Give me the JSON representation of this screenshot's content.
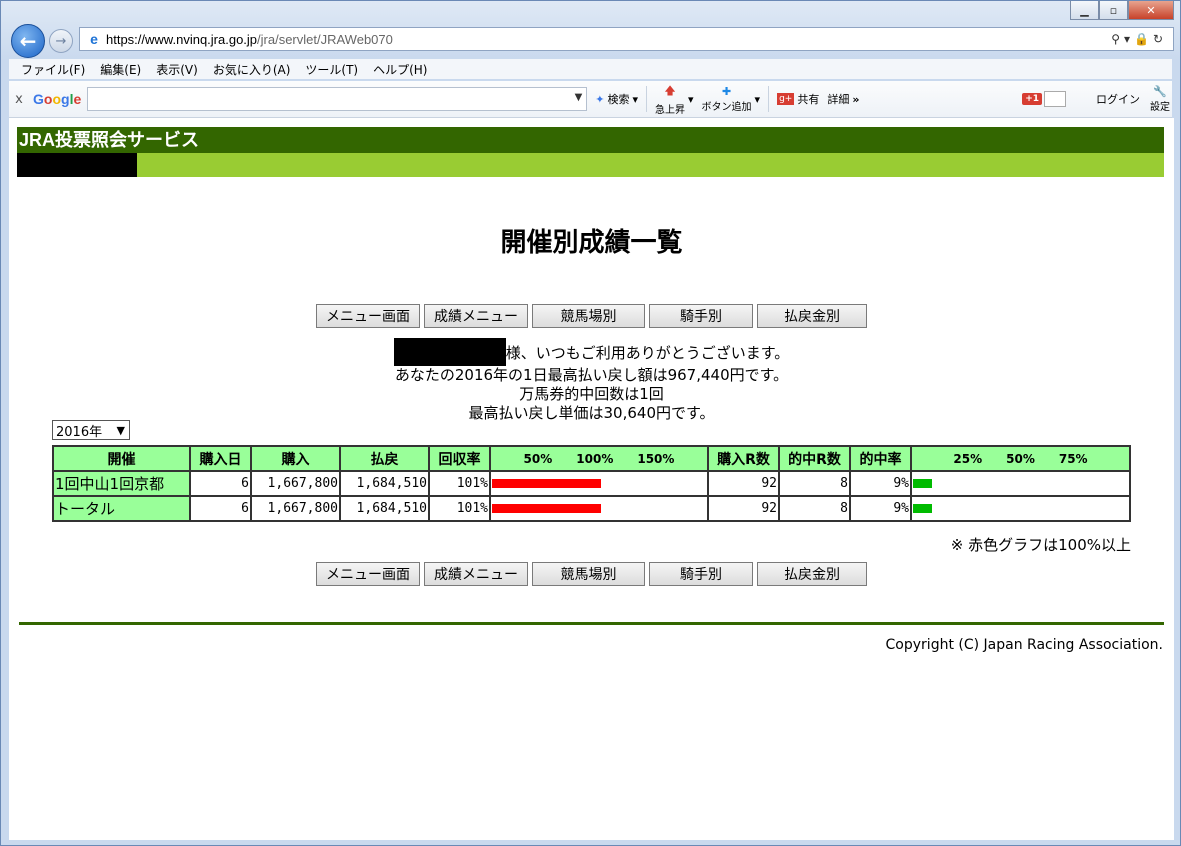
{
  "browser": {
    "url_https": "https://",
    "url_host": "www.nvinq.jra.go.jp",
    "url_path": "/jra/servlet/JRAWeb070",
    "menu": [
      "ファイル(F)",
      "編集(E)",
      "表示(V)",
      "お気に入り(A)",
      "ツール(T)",
      "ヘルプ(H)"
    ],
    "toolbar": {
      "close": "x",
      "google": "Google",
      "search": "検索",
      "rise": "急上昇",
      "add_button": "ボタン追加",
      "share": "共有",
      "detail": "詳細",
      "more": "»",
      "gplus": "+1",
      "login": "ログイン",
      "settings": "設定"
    }
  },
  "page": {
    "header_title": "JRA投票照会サービス",
    "title": "開催別成績一覧",
    "nav_buttons": [
      "メニュー画面",
      "成績メニュー",
      "競馬場別",
      "騎手別",
      "払戻金別"
    ],
    "message": {
      "line1_suffix": "様、いつもご利用ありがとうございます。",
      "line2": "あなたの2016年の1日最高払い戻し額は967,440円です。",
      "line3": "万馬券的中回数は1回",
      "line4": "最高払い戻し単価は30,640円です。"
    },
    "year_select": "2016年",
    "table": {
      "headers": [
        "開催",
        "購入日",
        "購入",
        "払戻",
        "回収率",
        "購入R数",
        "的中R数",
        "的中率"
      ],
      "return_scale": [
        "50%",
        "100%",
        "150%"
      ],
      "hit_scale": [
        "25%",
        "50%",
        "75%"
      ],
      "rows": [
        {
          "name": "1回中山1回京都",
          "days": "6",
          "purchase": "1,667,800",
          "payout": "1,684,510",
          "return_rate": "101%",
          "return_value": 101,
          "races": "92",
          "hits": "8",
          "hit_rate": "9%",
          "hit_value": 9
        },
        {
          "name": "トータル",
          "days": "6",
          "purchase": "1,667,800",
          "payout": "1,684,510",
          "return_rate": "101%",
          "return_value": 101,
          "races": "92",
          "hits": "8",
          "hit_rate": "9%",
          "hit_value": 9
        }
      ]
    },
    "note": "※ 赤色グラフは100%以上",
    "copyright": "Copyright (C) Japan Racing Association.",
    "colors": {
      "return_bar": "#ff0000",
      "hit_bar": "#00bb00",
      "header_dark": "#336600",
      "header_light": "#99cc33",
      "table_header": "#99ff99"
    }
  }
}
